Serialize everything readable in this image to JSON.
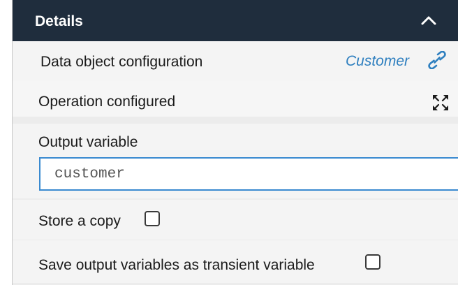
{
  "header": {
    "title": "Details",
    "collapse_icon": "chevron-up-icon"
  },
  "data_object": {
    "label": "Data object configuration",
    "value": "Customer",
    "link_icon": "link-icon"
  },
  "operation": {
    "label": "Operation configured",
    "expand_icon": "expand-icon"
  },
  "output_variable": {
    "label": "Output variable",
    "value": "customer"
  },
  "store_copy": {
    "label": "Store a copy",
    "checked": false
  },
  "transient": {
    "label": "Save output variables as transient variable",
    "checked": false
  },
  "colors": {
    "header_bg": "#1f2d3d",
    "link": "#2e7fbf",
    "input_border": "#3a8ad0"
  }
}
